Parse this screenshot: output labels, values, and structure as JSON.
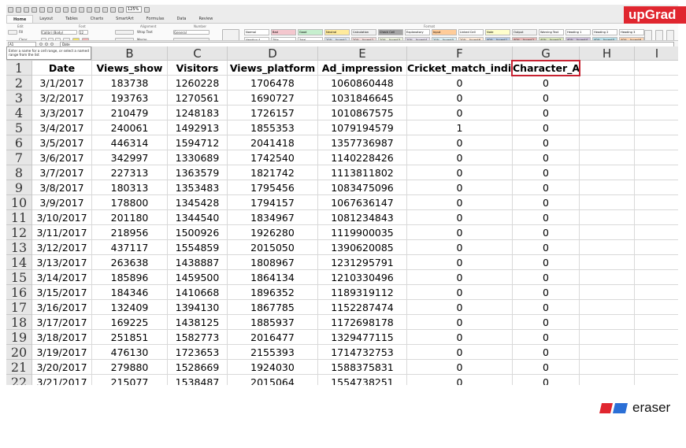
{
  "ribbon": {
    "tabs": [
      "Home",
      "Layout",
      "Tables",
      "Charts",
      "SmartArt",
      "Formulas",
      "Data",
      "Review"
    ],
    "active_tab": "Home",
    "zoom": "125%",
    "groups": [
      "Edit",
      "Font",
      "Alignment",
      "Number",
      "Format"
    ],
    "font_name": "Calibri (Body)",
    "font_size": "12",
    "wrap_text": "Wrap Text",
    "number_format": "General",
    "fill_label": "Fill",
    "clear_label": "Clear",
    "merge_label": "Merge",
    "conditional_formatting": "Conditional Formatting",
    "style_cells": [
      "Normal",
      "Bad",
      "Good",
      "Neutral",
      "Calculation",
      "Check Cell",
      "Explanatory",
      "Input",
      "Linked Cell",
      "Note",
      "Output",
      "Warning Text",
      "Heading 1",
      "Heading 2",
      "Heading 3"
    ],
    "style_cells_row2": [
      "Heading 4",
      "Title",
      "Total",
      "20% - Accent1",
      "20% - Accent2",
      "20% - Accent3",
      "20% - Accent4",
      "20% - Accent5",
      "20% - Accent6",
      "40% - Accent1",
      "40% - Accent2",
      "40% - Accent3",
      "40% - Accent4",
      "40% - Accent5",
      "40% - Accent6"
    ],
    "right_buttons": [
      "Insert",
      "Delete",
      "Format"
    ]
  },
  "brand": {
    "upgrad": "upGrad",
    "eraser": "eraser"
  },
  "formula_bar": {
    "name_box": "A1",
    "formula": "Date"
  },
  "tooltip": "Enter a name for a cell range, or select a named range from the list",
  "columns": [
    "A",
    "B",
    "C",
    "D",
    "E",
    "F",
    "G",
    "H",
    "I"
  ],
  "header_row": [
    "Date",
    "Views_show",
    "Visitors",
    "Views_platform",
    "Ad_impression",
    "Cricket_match_india",
    "Character_A",
    "",
    ""
  ],
  "rows": [
    [
      "3/1/2017",
      "183738",
      "1260228",
      "1706478",
      "1060860448",
      "0",
      "0"
    ],
    [
      "3/2/2017",
      "193763",
      "1270561",
      "1690727",
      "1031846645",
      "0",
      "0"
    ],
    [
      "3/3/2017",
      "210479",
      "1248183",
      "1726157",
      "1010867575",
      "0",
      "0"
    ],
    [
      "3/4/2017",
      "240061",
      "1492913",
      "1855353",
      "1079194579",
      "1",
      "0"
    ],
    [
      "3/5/2017",
      "446314",
      "1594712",
      "2041418",
      "1357736987",
      "0",
      "0"
    ],
    [
      "3/6/2017",
      "342997",
      "1330689",
      "1742540",
      "1140228426",
      "0",
      "0"
    ],
    [
      "3/7/2017",
      "227313",
      "1363579",
      "1821742",
      "1113811802",
      "0",
      "0"
    ],
    [
      "3/8/2017",
      "180313",
      "1353483",
      "1795456",
      "1083475096",
      "0",
      "0"
    ],
    [
      "3/9/2017",
      "178800",
      "1345428",
      "1794157",
      "1067636147",
      "0",
      "0"
    ],
    [
      "3/10/2017",
      "201180",
      "1344540",
      "1834967",
      "1081234843",
      "0",
      "0"
    ],
    [
      "3/11/2017",
      "218956",
      "1500926",
      "1926280",
      "1119900035",
      "0",
      "0"
    ],
    [
      "3/12/2017",
      "437117",
      "1554859",
      "2015050",
      "1390620085",
      "0",
      "0"
    ],
    [
      "3/13/2017",
      "263638",
      "1438887",
      "1808967",
      "1231295791",
      "0",
      "0"
    ],
    [
      "3/14/2017",
      "185896",
      "1459500",
      "1864134",
      "1210330496",
      "0",
      "0"
    ],
    [
      "3/15/2017",
      "184346",
      "1410668",
      "1896352",
      "1189319112",
      "0",
      "0"
    ],
    [
      "3/16/2017",
      "132409",
      "1394130",
      "1867785",
      "1152287474",
      "0",
      "0"
    ],
    [
      "3/17/2017",
      "169225",
      "1438125",
      "1885937",
      "1172698178",
      "0",
      "0"
    ],
    [
      "3/18/2017",
      "251851",
      "1582773",
      "2016477",
      "1329477115",
      "0",
      "0"
    ],
    [
      "3/19/2017",
      "476130",
      "1723653",
      "2155393",
      "1714732753",
      "0",
      "0"
    ],
    [
      "3/20/2017",
      "279880",
      "1528669",
      "1924030",
      "1588375831",
      "0",
      "0"
    ],
    [
      "3/21/2017",
      "215077",
      "1538487",
      "2015064",
      "1554738251",
      "0",
      "0"
    ]
  ],
  "highlight_color": "#c82232",
  "eraser_colors": [
    "#e0262f",
    "#2b6fd6"
  ]
}
